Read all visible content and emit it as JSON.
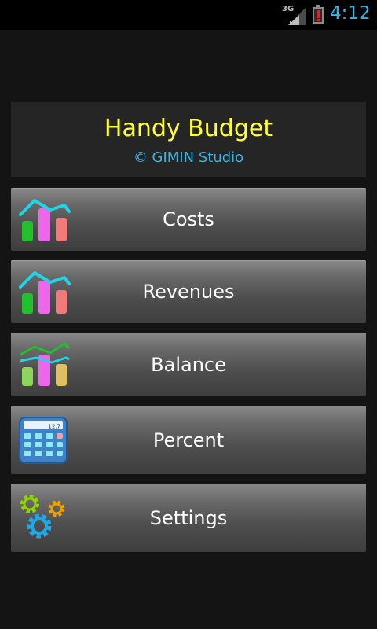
{
  "status_bar": {
    "network": "3G",
    "time": "4:12",
    "icons": [
      "signal-icon",
      "battery-alert-icon"
    ]
  },
  "header": {
    "title": "Handy Budget",
    "subtitle": "© GIMIN Studio"
  },
  "menu": [
    {
      "label": "Costs",
      "icon": "costs-chart-icon"
    },
    {
      "label": "Revenues",
      "icon": "revenues-chart-icon"
    },
    {
      "label": "Balance",
      "icon": "balance-chart-icon"
    },
    {
      "label": "Percent",
      "icon": "calculator-icon",
      "calculator_display": "12.7"
    },
    {
      "label": "Settings",
      "icon": "gears-icon"
    }
  ],
  "colors": {
    "title": "#ffff33",
    "accent": "#33b5e5",
    "background": "#141414",
    "header_bg": "#252525"
  }
}
